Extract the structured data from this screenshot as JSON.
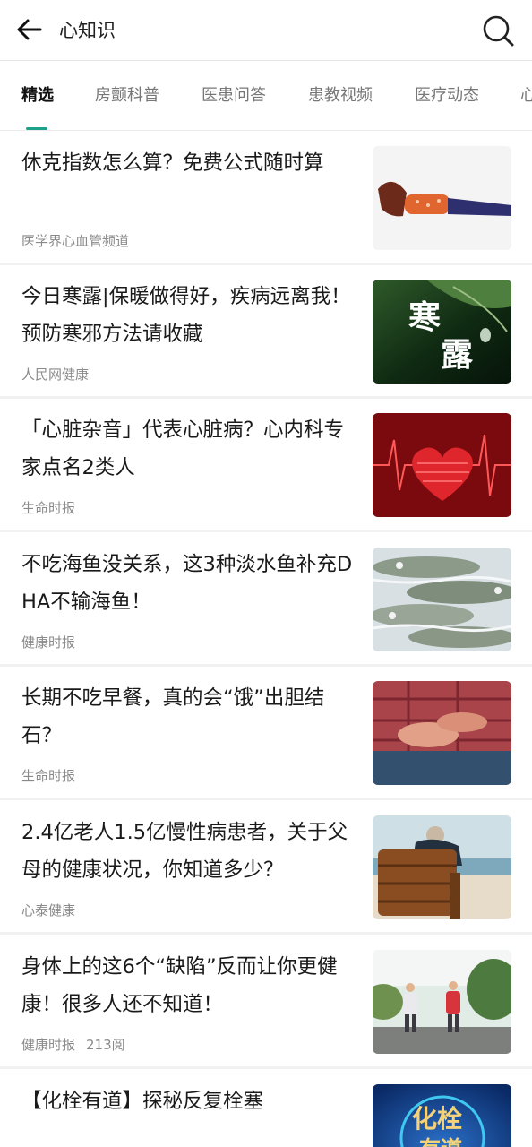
{
  "header": {
    "title": "心知识",
    "back_icon": "arrow-left-icon",
    "search_icon": "search-icon"
  },
  "tabs": [
    {
      "label": "精选",
      "active": true
    },
    {
      "label": "房颤科普",
      "active": false
    },
    {
      "label": "医患问答",
      "active": false
    },
    {
      "label": "患教视频",
      "active": false
    },
    {
      "label": "医疗动态",
      "active": false
    },
    {
      "label": "心",
      "active": false
    }
  ],
  "articles": [
    {
      "title": "休克指数怎么算？免费公式随时算",
      "source": "医学界心血管频道",
      "views": ""
    },
    {
      "title": "今日寒露|保暖做得好，疾病远离我！预防寒邪方法请收藏",
      "source": "人民网健康",
      "views": "",
      "thumb_text_1": "寒",
      "thumb_text_2": "露"
    },
    {
      "title": "「心脏杂音」代表心脏病？心内科专家点名2类人",
      "source": "生命时报",
      "views": ""
    },
    {
      "title": "不吃海鱼没关系，这3种淡水鱼补充DHA不输海鱼！",
      "source": "健康时报",
      "views": ""
    },
    {
      "title": "长期不吃早餐，真的会“饿”出胆结石？",
      "source": "生命时报",
      "views": ""
    },
    {
      "title": "2.4亿老人1.5亿慢性病患者，关于父母的健康状况，你知道多少？",
      "source": "心泰健康",
      "views": ""
    },
    {
      "title": "身体上的这6个“缺陷”反而让你更健康！很多人还不知道！",
      "source": "健康时报",
      "views": "213阅"
    },
    {
      "title": "【化栓有道】探秘反复栓塞",
      "source": "",
      "views": "",
      "thumb_text_1": "化栓",
      "thumb_text_2": "有道"
    }
  ],
  "colors": {
    "accent": "#1aa38a",
    "title_text": "#1a1a1a",
    "meta_text": "#8a8a8a",
    "tab_inactive": "#777777"
  }
}
